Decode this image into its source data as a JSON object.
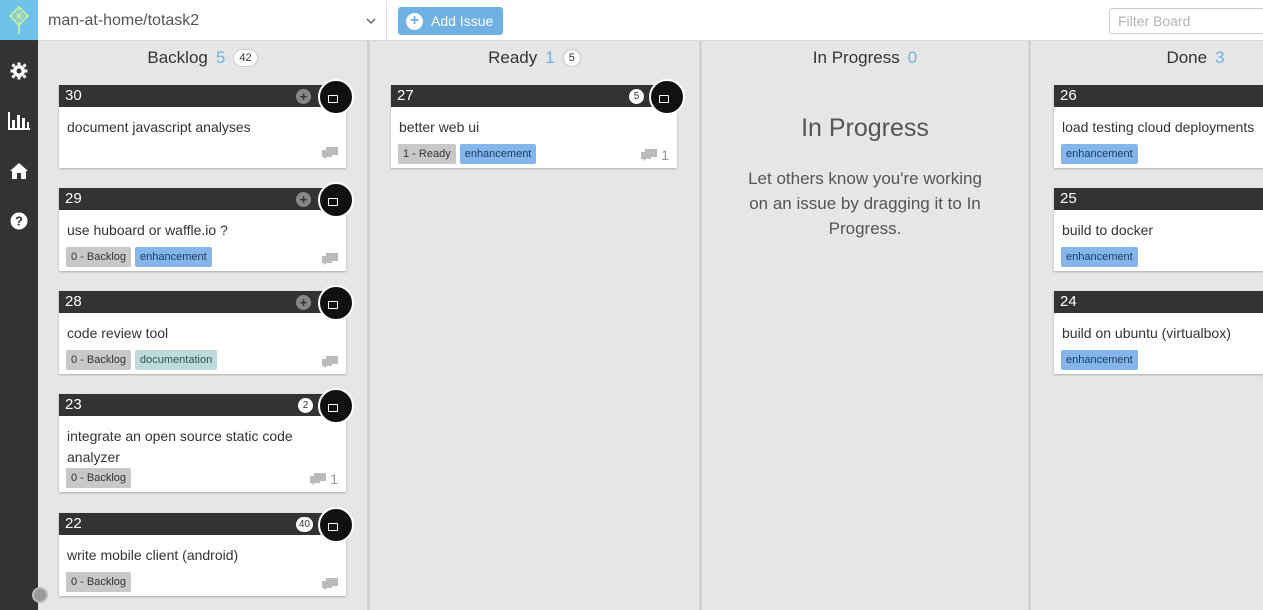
{
  "header": {
    "repo": "man-at-home/totask2",
    "add_issue": "Add Issue",
    "filter_placeholder": "Filter Board"
  },
  "sidebar": {
    "icons": [
      "gear-icon",
      "chart-icon",
      "home-icon",
      "help-icon"
    ]
  },
  "columns": [
    {
      "name": "Backlog",
      "count": "5",
      "total": "42"
    },
    {
      "name": "Ready",
      "count": "1",
      "total": "5"
    },
    {
      "name": "In Progress",
      "count": "0"
    },
    {
      "name": "Done",
      "count": "3"
    }
  ],
  "backlog_cards": [
    {
      "number": "30",
      "title": "document javascript analyses",
      "badge": "+"
    },
    {
      "number": "29",
      "title": "use huboard or waffle.io ?",
      "badge": "+",
      "labels": [
        "0 - Backlog",
        "enhancement"
      ]
    },
    {
      "number": "28",
      "title": "code review tool",
      "badge": "+",
      "labels": [
        "0 - Backlog",
        "documentation"
      ]
    },
    {
      "number": "23",
      "title": "integrate an open source static code analyzer",
      "badge": "2",
      "labels": [
        "0 - Backlog"
      ],
      "comments": "1"
    },
    {
      "number": "22",
      "title": "write mobile client (android)",
      "badge": "40",
      "labels": [
        "0 - Backlog"
      ]
    }
  ],
  "ready_cards": [
    {
      "number": "27",
      "title": "better web ui",
      "badge": "5",
      "labels": [
        "1 - Ready",
        "enhancement"
      ],
      "comments": "1"
    }
  ],
  "in_progress_empty": {
    "title": "In Progress",
    "text": "Let others know you're working on an issue by dragging it to In Progress."
  },
  "done_cards": [
    {
      "number": "26",
      "title": "load testing cloud deployments",
      "labels": [
        "enhancement"
      ]
    },
    {
      "number": "25",
      "title": "build to docker",
      "labels": [
        "enhancement"
      ]
    },
    {
      "number": "24",
      "title": "build on ubuntu (virtualbox)",
      "labels": [
        "enhancement"
      ]
    }
  ]
}
